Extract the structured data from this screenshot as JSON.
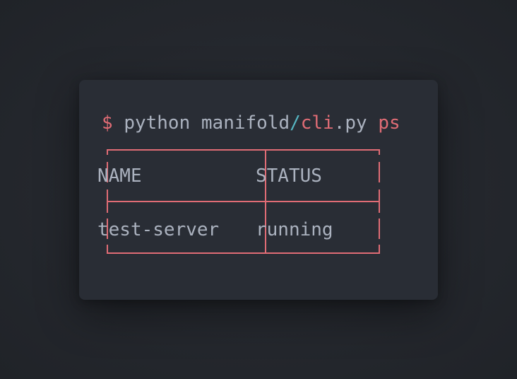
{
  "terminal": {
    "prompt_symbol": "$",
    "command": "python",
    "path_dir": "manifold",
    "path_sep": "/",
    "path_file": "cli",
    "path_ext": ".py",
    "argument": "ps"
  },
  "table": {
    "columns": [
      "NAME",
      "STATUS"
    ],
    "rows": [
      [
        "test-server",
        "running"
      ]
    ]
  },
  "colors": {
    "background": "#24272d",
    "card": "#292d35",
    "text": "#abb2bf",
    "accent_red": "#e06c75",
    "accent_cyan": "#56b6c2"
  }
}
